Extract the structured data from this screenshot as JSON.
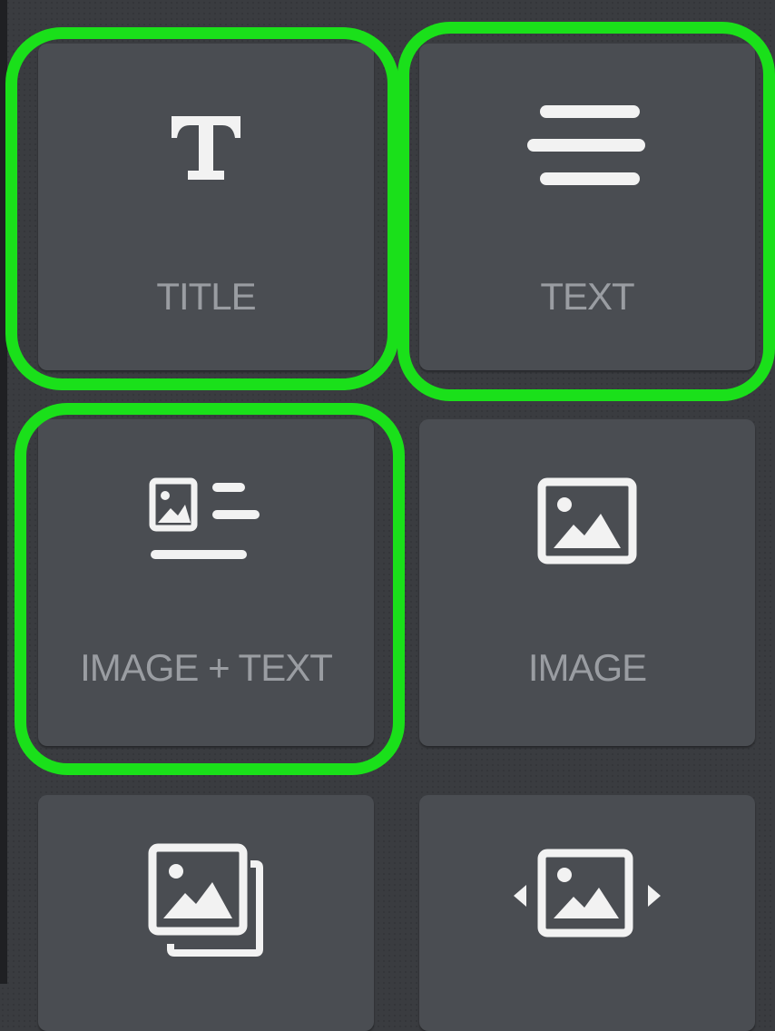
{
  "blocks": [
    {
      "label": "TITLE",
      "icon": "title-t-icon",
      "highlighted": true
    },
    {
      "label": "TEXT",
      "icon": "text-lines-icon",
      "highlighted": true
    },
    {
      "label": "IMAGE + TEXT",
      "icon": "image-text-icon",
      "highlighted": true
    },
    {
      "label": "IMAGE",
      "icon": "image-icon",
      "highlighted": false
    },
    {
      "label": "",
      "icon": "gallery-icon",
      "highlighted": false
    },
    {
      "label": "",
      "icon": "slider-icon",
      "highlighted": false
    }
  ],
  "colors": {
    "tile": "#4a4d52",
    "label": "#9a9da2",
    "icon": "#f2f2f2",
    "highlight": "#1ae01a",
    "background": "#3a3c40"
  }
}
